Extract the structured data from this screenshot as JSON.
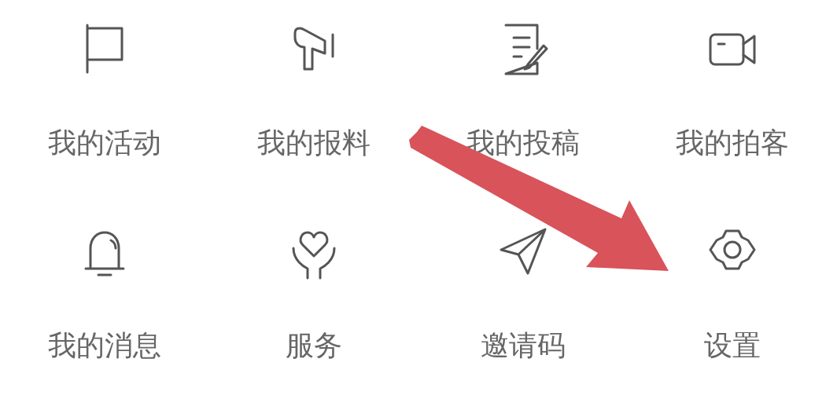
{
  "menu_items": [
    {
      "label": "我的活动",
      "kind": "flag"
    },
    {
      "label": "我的报料",
      "kind": "megaphone"
    },
    {
      "label": "我的投稿",
      "kind": "document"
    },
    {
      "label": "我的拍客",
      "kind": "video"
    },
    {
      "label": "我的消息",
      "kind": "bell"
    },
    {
      "label": "服务",
      "kind": "heart"
    },
    {
      "label": "邀请码",
      "kind": "send"
    },
    {
      "label": "设置",
      "kind": "gear"
    }
  ]
}
